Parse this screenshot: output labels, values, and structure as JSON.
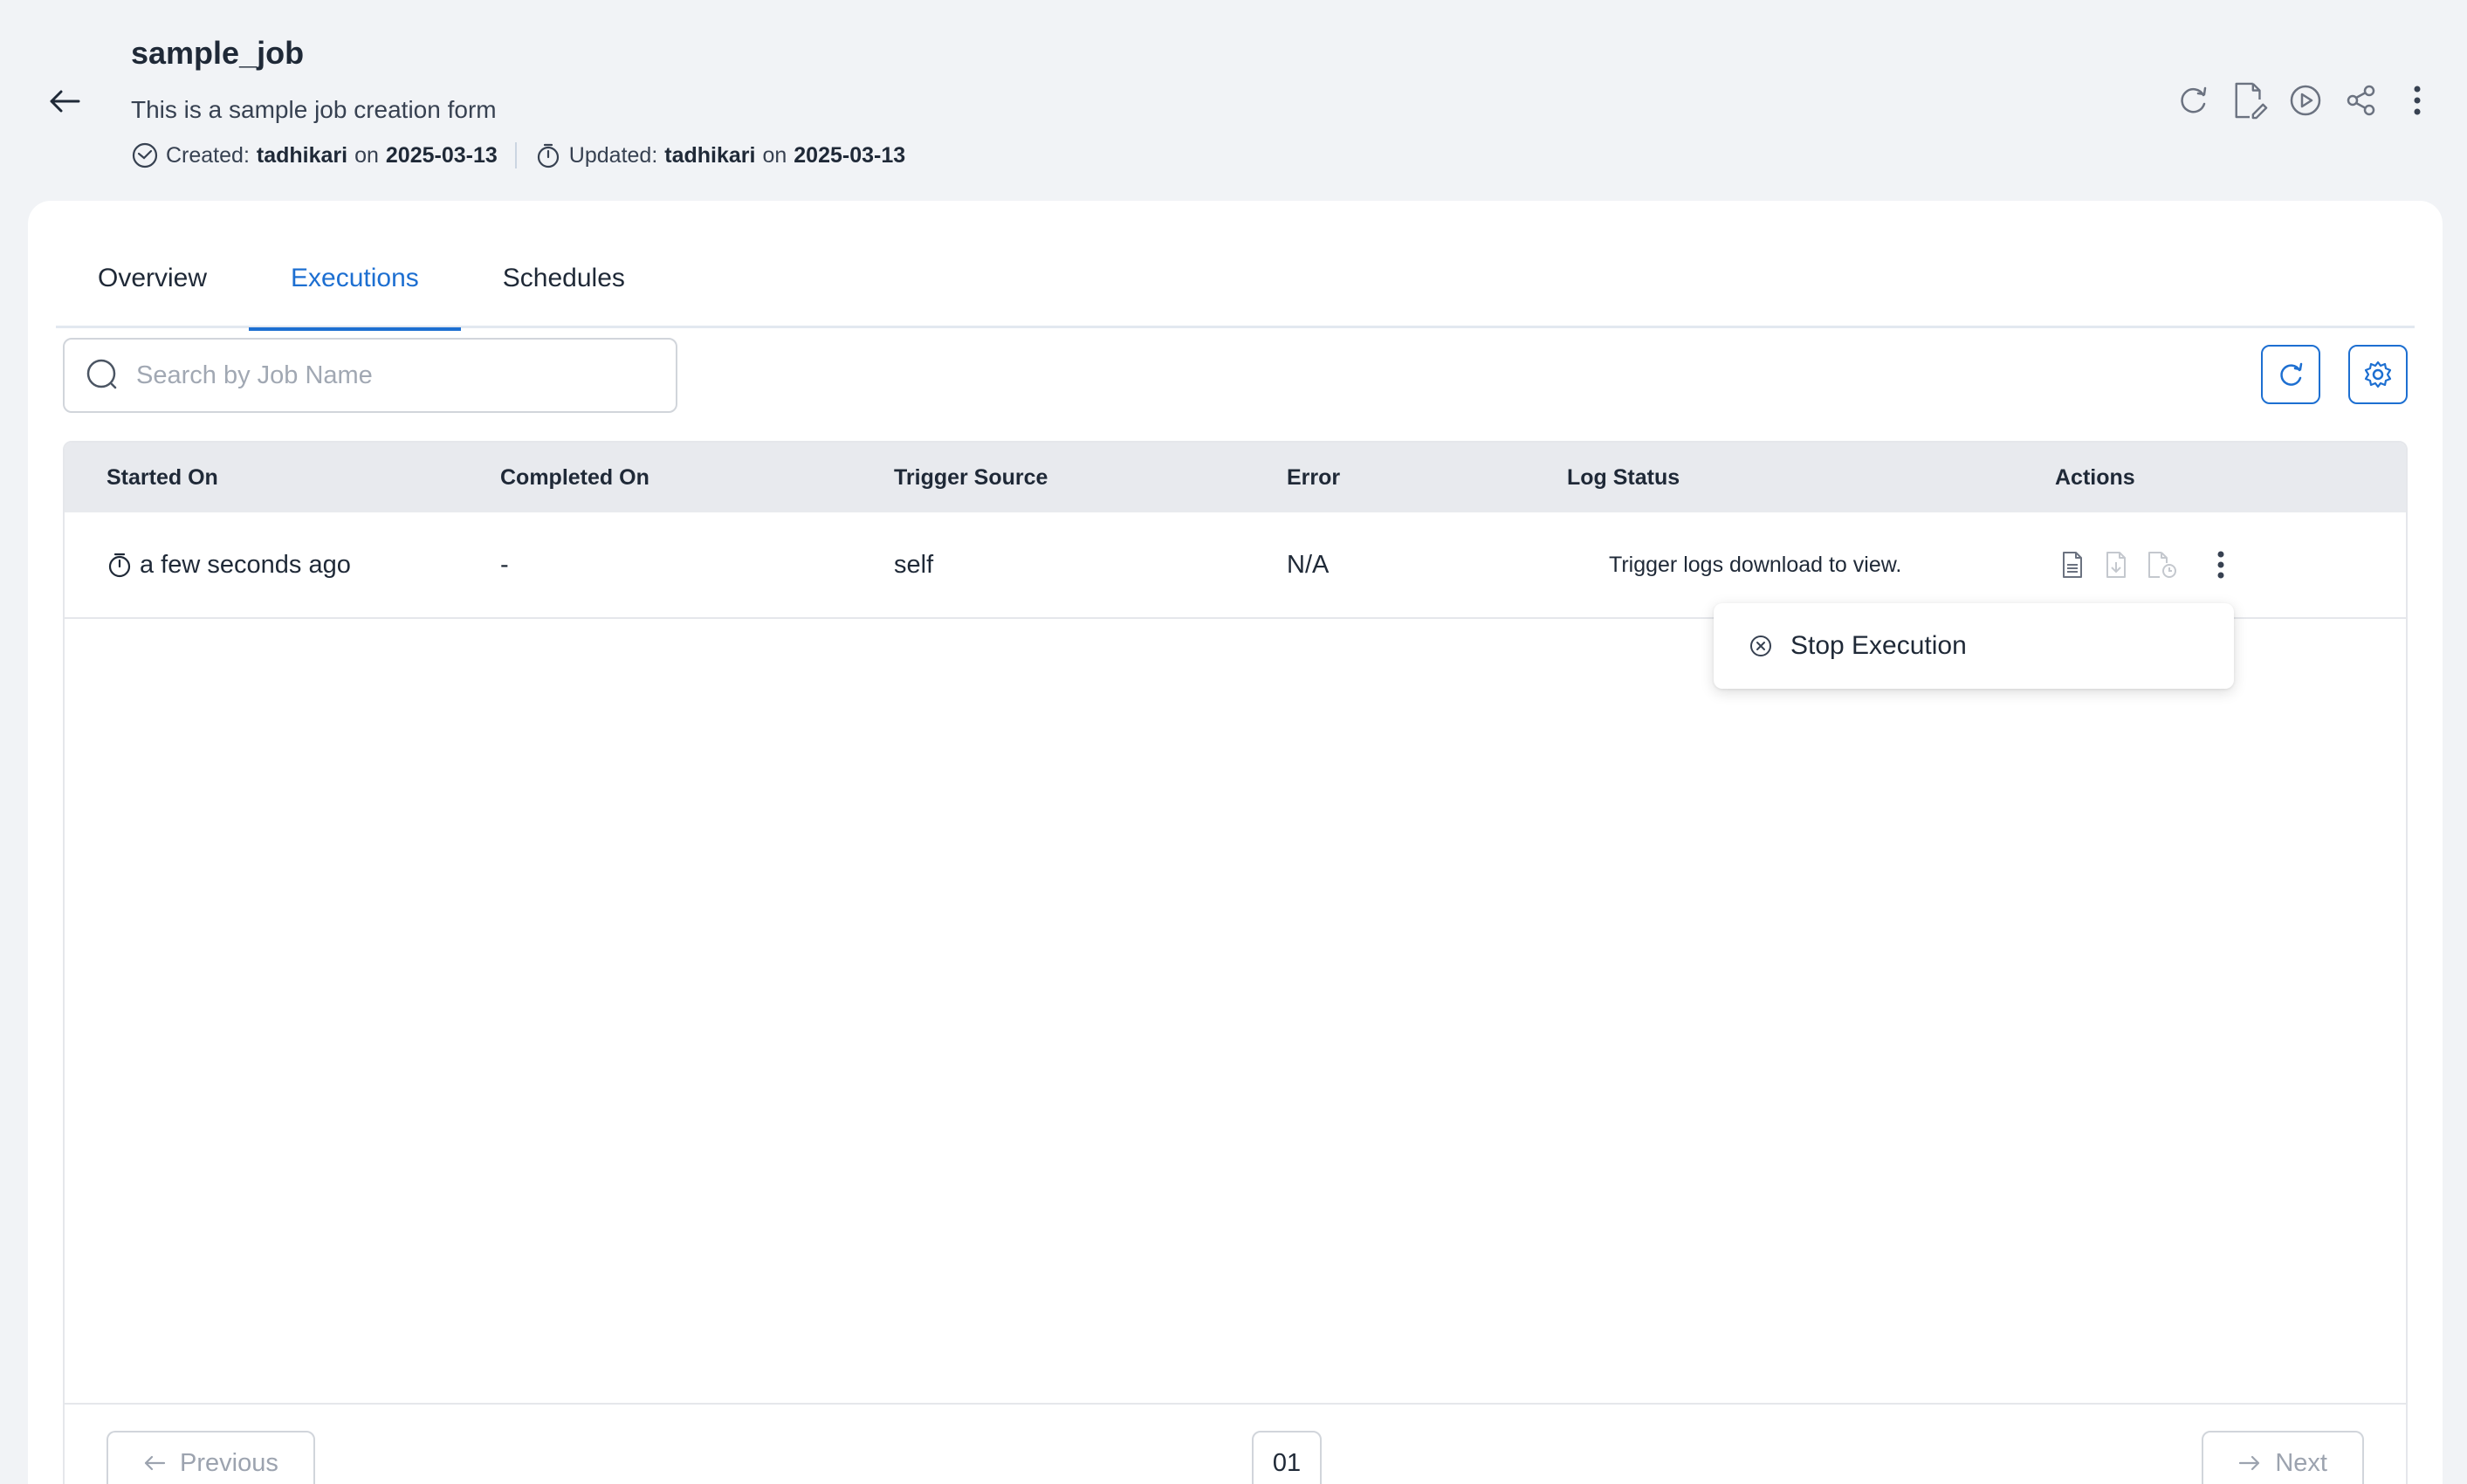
{
  "header": {
    "title": "sample_job",
    "description": "This is a sample job creation form",
    "created_label": "Created:",
    "created_by": "tadhikari",
    "created_on_word": "on",
    "created_date": "2025-03-13",
    "updated_label": "Updated:",
    "updated_by": "tadhikari",
    "updated_on_word": "on",
    "updated_date": "2025-03-13",
    "actions": [
      "refresh-icon",
      "edit-file-icon",
      "play-circle-icon",
      "share-icon",
      "more-vertical-icon"
    ]
  },
  "tabs": [
    {
      "label": "Overview",
      "active": false
    },
    {
      "label": "Executions",
      "active": true
    },
    {
      "label": "Schedules",
      "active": false
    }
  ],
  "search": {
    "placeholder": "Search by Job Name",
    "value": ""
  },
  "toolbar": {
    "refresh_icon": "refresh-icon",
    "settings_icon": "gear-icon"
  },
  "table": {
    "columns": [
      "Started On",
      "Completed On",
      "Trigger Source",
      "Error",
      "Log Status",
      "Actions"
    ],
    "rows": [
      {
        "started_on": "a few seconds ago",
        "completed_on": "-",
        "trigger_source": "self",
        "error": "N/A",
        "log_status": "Trigger logs download to view.",
        "actions": [
          "view-log-icon",
          "download-log-icon",
          "log-history-icon",
          "more-vertical-icon"
        ]
      }
    ]
  },
  "row_menu": {
    "items": [
      {
        "label": "Stop Execution",
        "icon": "close-circle-icon"
      }
    ]
  },
  "pagination": {
    "previous": "Previous",
    "page": "01",
    "next": "Next"
  },
  "colors": {
    "accent": "#1d6fd1",
    "header_bg": "#e8eaee",
    "page_bg": "#f1f3f6"
  }
}
